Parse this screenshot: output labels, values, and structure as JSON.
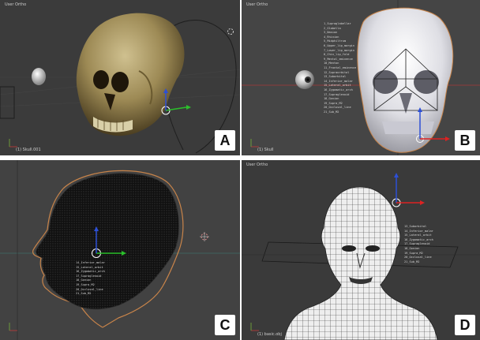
{
  "panels": {
    "a": {
      "header": "User Ortho",
      "footer": "(1) Skull.001",
      "badge": "A"
    },
    "b": {
      "header": "User Ortho",
      "footer": "(1) Skull",
      "badge": "B",
      "labels": [
        "1_Supraglabellar",
        "2_Glabella",
        "3_Nasion",
        "4_Rhinion",
        "5_Midphiltrum",
        "6_Upper_lip_margin",
        "7_Lower_lip_margin",
        "8_Chin_lip_fold",
        "9_Mental_eminence",
        "10_Menton",
        "11_Frontal_eminence",
        "12_Supraorbital",
        "13_Suborbital",
        "14_Inferior_malar",
        "15_Lateral_orbit",
        "16_Zygomatic_arch",
        "17_Supraglenoid",
        "18_Gonion",
        "19_Supra_M2",
        "20_Occlusal_line",
        "21_Sub_M2"
      ]
    },
    "c": {
      "badge": "C",
      "labels": [
        "14_Inferior_malar",
        "15_Lateral_orbit",
        "16_Zygomatic_arch",
        "17_Supraglenoid",
        "18_Gonion",
        "19_Supra_M2",
        "20_Occlusal_line",
        "21_Sub_M2"
      ]
    },
    "d": {
      "header": "User Ortho",
      "footer": "(1) basic.obj",
      "badge": "D",
      "labels": [
        "13_Suborbital",
        "14_Inferior_malar",
        "15_Lateral_orbit",
        "16_Zygomatic_arch",
        "17_Supraglenoid",
        "18_Gonion",
        "19_Supra_M2",
        "20_Occlusal_line",
        "21_Sub_M2"
      ]
    }
  },
  "colors": {
    "viewport_bg": "#3b3b3b",
    "grid_line": "#2f2f2f",
    "x_axis": "#a83a3a",
    "y_axis": "#6c9a3a",
    "gizmo_blue": "#2c4fd6",
    "gizmo_red": "#d22",
    "gizmo_green": "#2bbf2b",
    "outline_orange": "#c8844a",
    "badge_bg": "#ffffff"
  },
  "icons": [
    "transform-gizmo-icon",
    "camera-icon",
    "3d-cursor-icon",
    "eyeball-icon"
  ]
}
